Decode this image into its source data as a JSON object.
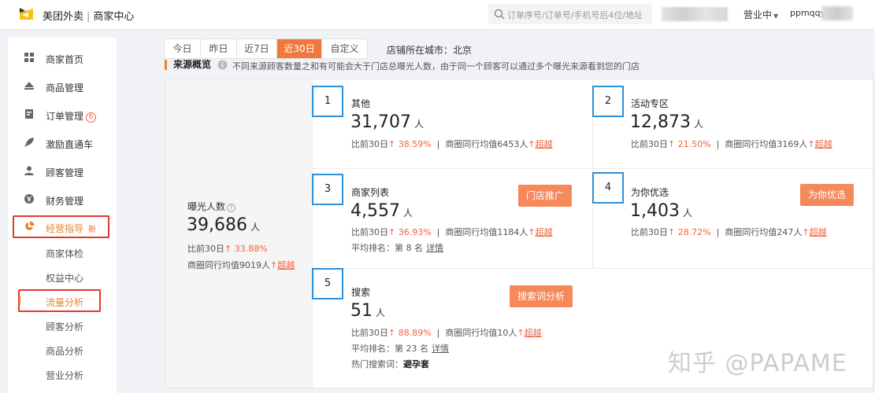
{
  "header": {
    "brand": "美团外卖",
    "subtitle": "商家中心",
    "search_placeholder": "订单序号/订单号/手机号后4位/地址",
    "status": "营业中",
    "user": "ppmqqy",
    "accent_color": "#f0783c"
  },
  "sidebar": {
    "items": [
      {
        "label": "商家首页",
        "icon": "grid-icon"
      },
      {
        "label": "商品管理",
        "icon": "eject-icon"
      },
      {
        "label": "订单管理",
        "icon": "order-icon",
        "badge": "6"
      },
      {
        "label": "激励直通车",
        "icon": "rocket-icon"
      },
      {
        "label": "顾客管理",
        "icon": "user-icon"
      },
      {
        "label": "财务管理",
        "icon": "yen-icon"
      },
      {
        "label": "经营指导",
        "icon": "pie-icon",
        "tag": "新"
      }
    ],
    "sub_items": [
      "商家体检",
      "权益中心",
      "流量分析",
      "顾客分析",
      "商品分析",
      "营业分析"
    ]
  },
  "tabs": [
    "今日",
    "昨日",
    "近7日",
    "近30日",
    "自定义"
  ],
  "active_tab": "近30日",
  "city": "店铺所在城市：北京",
  "section": {
    "title": "来源概览",
    "note": "不同来源顾客数量之和有可能会大于门店总曝光人数，由于同一个顾客可以通过多个曝光来源看到您的门店"
  },
  "total": {
    "label": "曝光人数",
    "value": "39,686",
    "unit": "人",
    "cmp_prefix": "比前30日",
    "cmp_value": "33.88%",
    "peer_prefix": "商圈同行均值9019人",
    "peer_result": "超越"
  },
  "cards": [
    {
      "num": "1",
      "name": "其他",
      "value": "31,707",
      "unit": "人",
      "cmp": "38.59%",
      "peer": "商圈同行均值6453人",
      "result": "超越"
    },
    {
      "num": "2",
      "name": "活动专区",
      "value": "12,873",
      "unit": "人",
      "cmp": "21.50%",
      "peer": "商圈同行均值3169人",
      "result": "超越"
    },
    {
      "num": "3",
      "name": "商家列表",
      "value": "4,557",
      "unit": "人",
      "cmp": "36.93%",
      "peer": "商圈同行均值1184人",
      "result": "超越",
      "rank": "平均排名：第 8 名",
      "detail": "详情",
      "button": "门店推广"
    },
    {
      "num": "4",
      "name": "为你优选",
      "value": "1,403",
      "unit": "人",
      "cmp": "28.72%",
      "peer": "商圈同行均值247人",
      "result": "超越",
      "button": "为你优选"
    },
    {
      "num": "5",
      "name": "搜索",
      "value": "51",
      "unit": "人",
      "cmp": "88.89%",
      "peer": "商圈同行均值10人",
      "result": "超越",
      "rank": "平均排名：第 23 名",
      "detail": "详情",
      "hot_label": "热门搜索词：",
      "hot_word": "避孕套",
      "button": "搜索词分析"
    }
  ],
  "cmp_prefix": "比前30日",
  "watermark": "知乎 @PAPAME"
}
